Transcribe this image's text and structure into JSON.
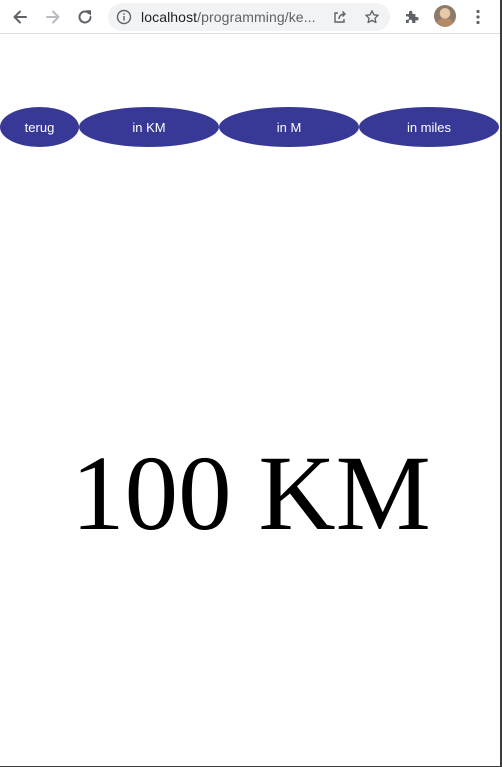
{
  "browser": {
    "url_host": "localhost",
    "url_path": "/programming/ke..."
  },
  "nav": {
    "back_label": "terug",
    "km_label": "in KM",
    "m_label": "in M",
    "miles_label": "in miles"
  },
  "main": {
    "distance": "100 KM"
  },
  "colors": {
    "button_bg": "#383896",
    "button_text": "#ffffff"
  }
}
